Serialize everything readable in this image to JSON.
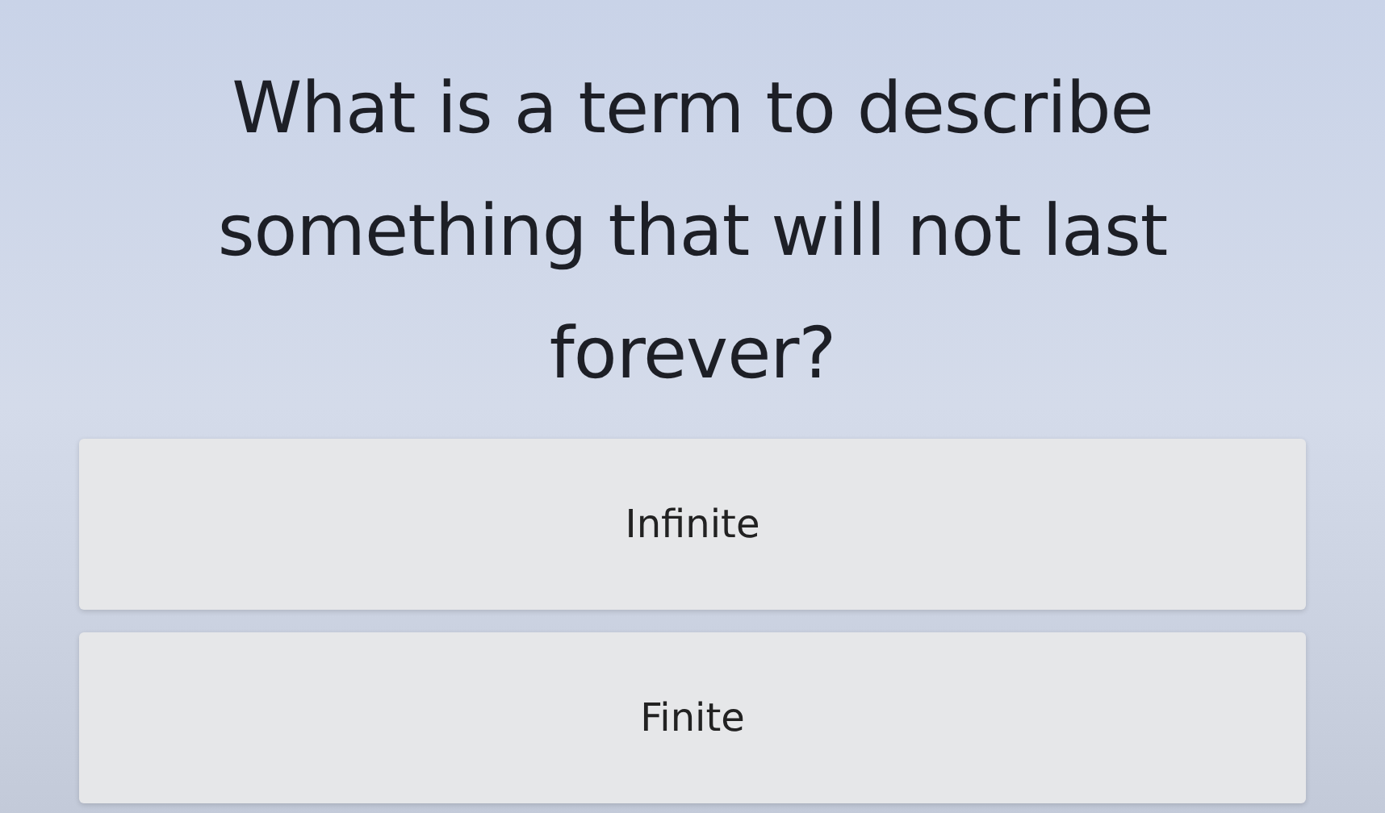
{
  "question": "What is a term to describe something that will not last forever?",
  "options": [
    {
      "label": "Infinite"
    },
    {
      "label": "Finite"
    }
  ]
}
